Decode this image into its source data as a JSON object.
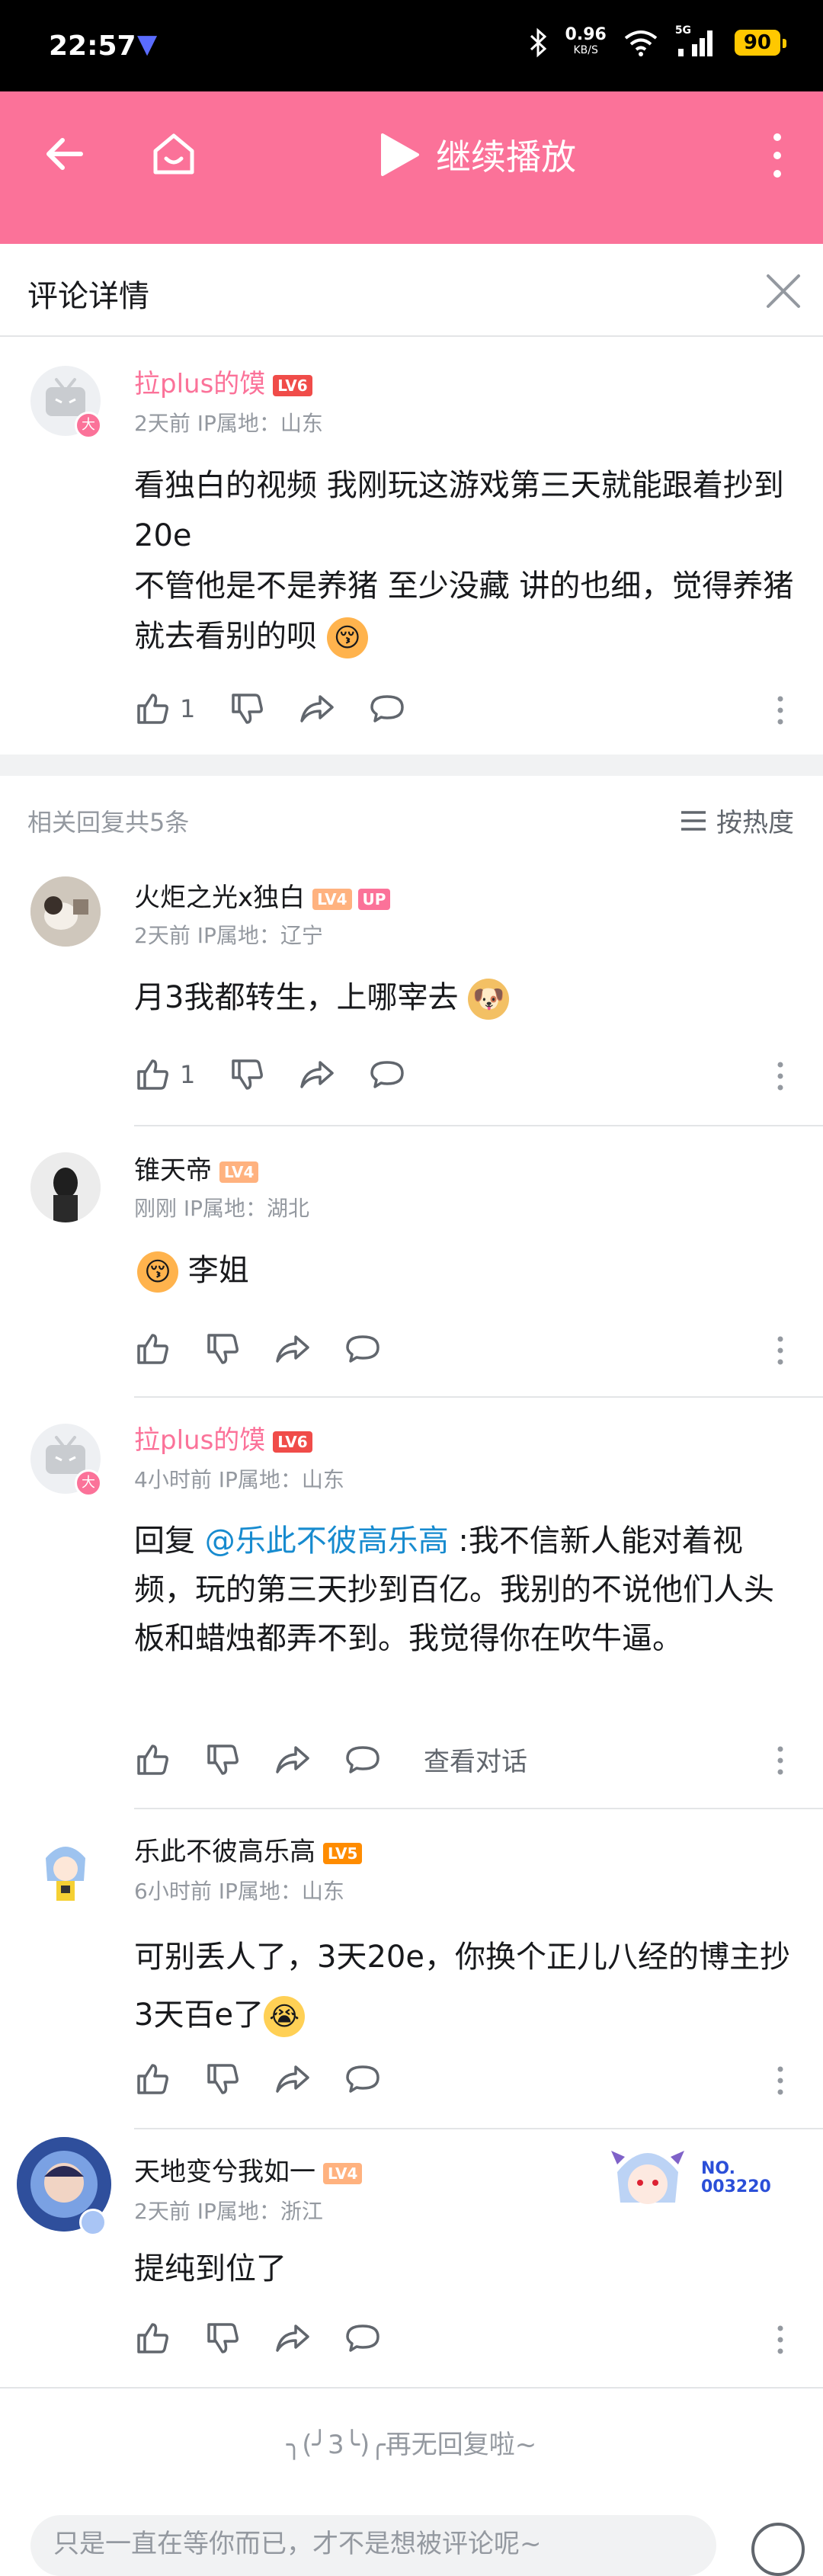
{
  "status_bar": {
    "time": "22:57",
    "net_speed": "0.96",
    "net_unit": "KB/S",
    "signal_label": "5G",
    "battery": "90"
  },
  "app_bar": {
    "play_label": "继续播放",
    "accent_color": "#fb7299"
  },
  "panel": {
    "title": "评论详情"
  },
  "root_comment": {
    "username": "拉plus的馍",
    "level": "LV6",
    "avatar_badge": "大",
    "meta": "2天前 IP属地：山东",
    "text_line1": "看独白的视频 我刚玩这游戏第三天就能跟着抄到20e",
    "text_line2": "不管他是不是养猪 至少没藏 讲的也细，觉得养猪就去看别的呗",
    "like_count": "1"
  },
  "replies_header": {
    "count_label": "相关回复共5条",
    "sort_label": "按热度"
  },
  "replies": [
    {
      "username": "火炬之光x独白",
      "level": "LV4",
      "up_tag": "UP",
      "meta": "2天前 IP属地：辽宁",
      "text": "月3我都转生，上哪宰去",
      "like_count": "1"
    },
    {
      "username": "锥天帝",
      "level": "LV4",
      "meta": "刚刚 IP属地：湖北",
      "text": "李姐"
    },
    {
      "username": "拉plus的馍",
      "level": "LV6",
      "avatar_badge": "大",
      "meta": "4小时前 IP属地：山东",
      "reply_prefix": "回复 ",
      "mention": "@乐此不彼高乐高",
      "text": " :我不信新人能对着视频，玩的第三天抄到百亿。我别的不说他们人头板和蜡烛都弄不到。我觉得你在吹牛逼。",
      "view_dialog": "查看对话"
    },
    {
      "username": "乐此不彼高乐高",
      "level": "LV5",
      "meta": "6小时前 IP属地：山东",
      "text": "可别丢人了，3天20e，你换个正儿八经的博主抄3天百e了"
    },
    {
      "username": "天地变兮我如一",
      "level": "LV4",
      "meta": "2天前 IP属地：浙江",
      "text": "提纯到位了",
      "fan_label": "NO.",
      "fan_number": "003220"
    }
  ],
  "end_hint": "╮(╯3╰)╭再无回复啦~",
  "input": {
    "placeholder": "只是一直在等你而已，才不是想被评论呢~"
  }
}
